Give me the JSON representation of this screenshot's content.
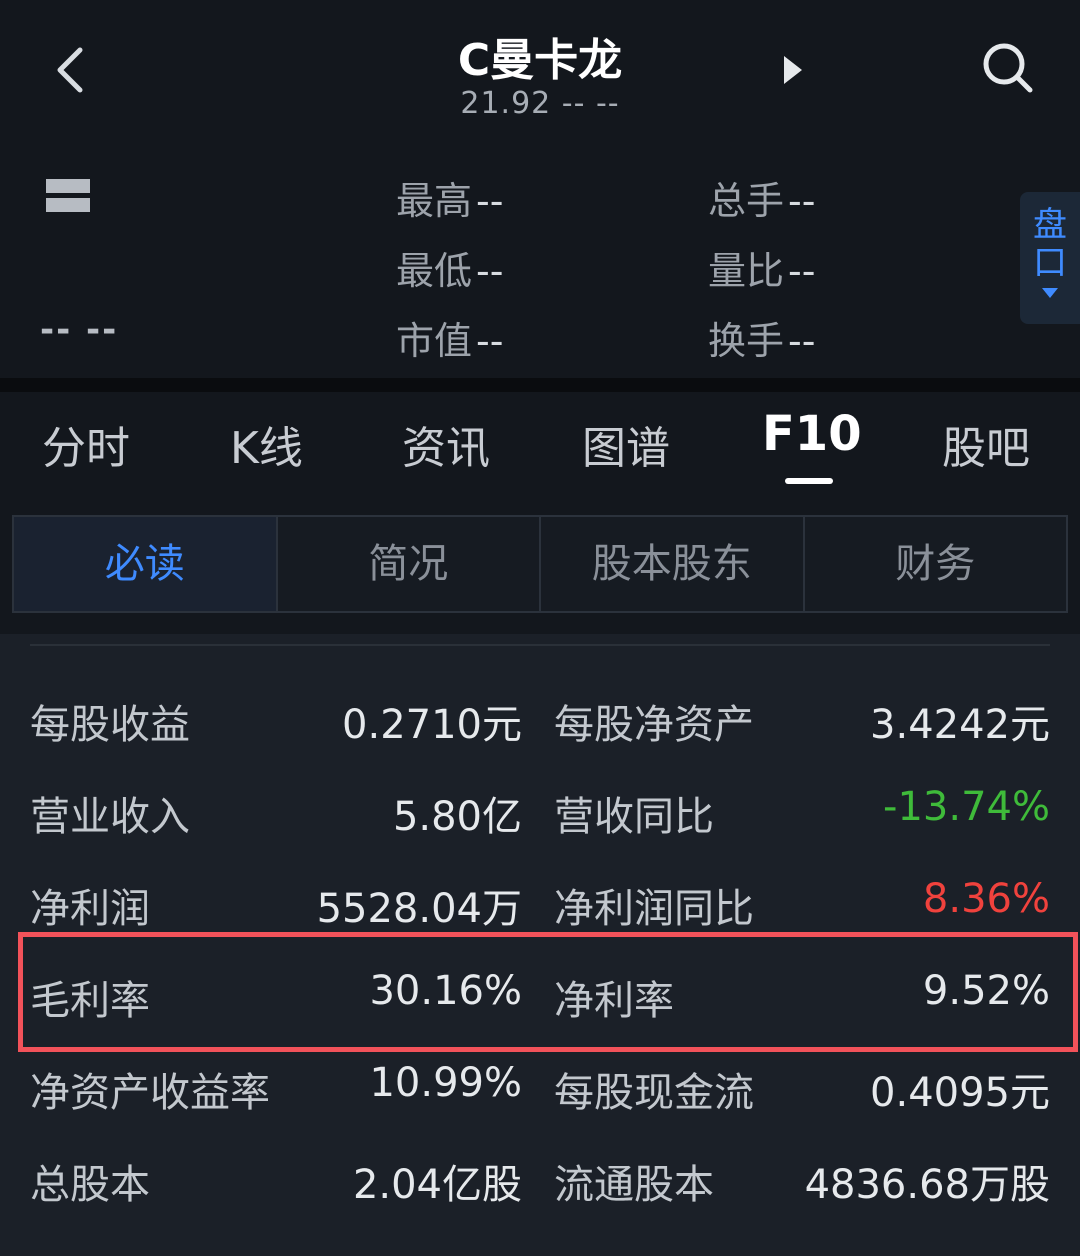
{
  "header": {
    "title": "C曼卡龙",
    "subtitle": "21.92  --  --",
    "price_placeholder": "--",
    "change_placeholder": "--   --"
  },
  "stats": [
    {
      "label": "最高",
      "value": "--"
    },
    {
      "label": "总手",
      "value": "--"
    },
    {
      "label": "最低",
      "value": "--"
    },
    {
      "label": "量比",
      "value": "--"
    },
    {
      "label": "市值",
      "value": "--"
    },
    {
      "label": "换手",
      "value": "--"
    }
  ],
  "pankou": {
    "line1": "盘",
    "line2": "口"
  },
  "tabs": [
    "分时",
    "K线",
    "资讯",
    "图谱",
    "F10",
    "股吧"
  ],
  "active_tab": "F10",
  "subtabs": [
    "必读",
    "简况",
    "股本股东",
    "财务"
  ],
  "active_subtab": "必读",
  "rows": [
    {
      "l1": "每股收益",
      "v1": "0.2710元",
      "l2": "每股净资产",
      "v2": "3.4242元"
    },
    {
      "l1": "营业收入",
      "v1": "5.80亿",
      "l2": "营收同比",
      "v2": "-13.74%"
    },
    {
      "l1": "净利润",
      "v1": "5528.04万",
      "l2": "净利润同比",
      "v2": "8.36%"
    },
    {
      "l1": "毛利率",
      "v1": "30.16%",
      "l2": "净利率",
      "v2": "9.52%"
    },
    {
      "l1": "净资产收益率",
      "v1": "10.99%",
      "l2": "每股现金流",
      "v2": "0.4095元"
    },
    {
      "l1": "总股本",
      "v1": "2.04亿股",
      "l2": "流通股本",
      "v2": "4836.68万股"
    }
  ],
  "colors": {
    "accent": "#3f8bff",
    "down": "#3fbb3a",
    "up": "#f0423d",
    "highlight": "#f2525a"
  }
}
